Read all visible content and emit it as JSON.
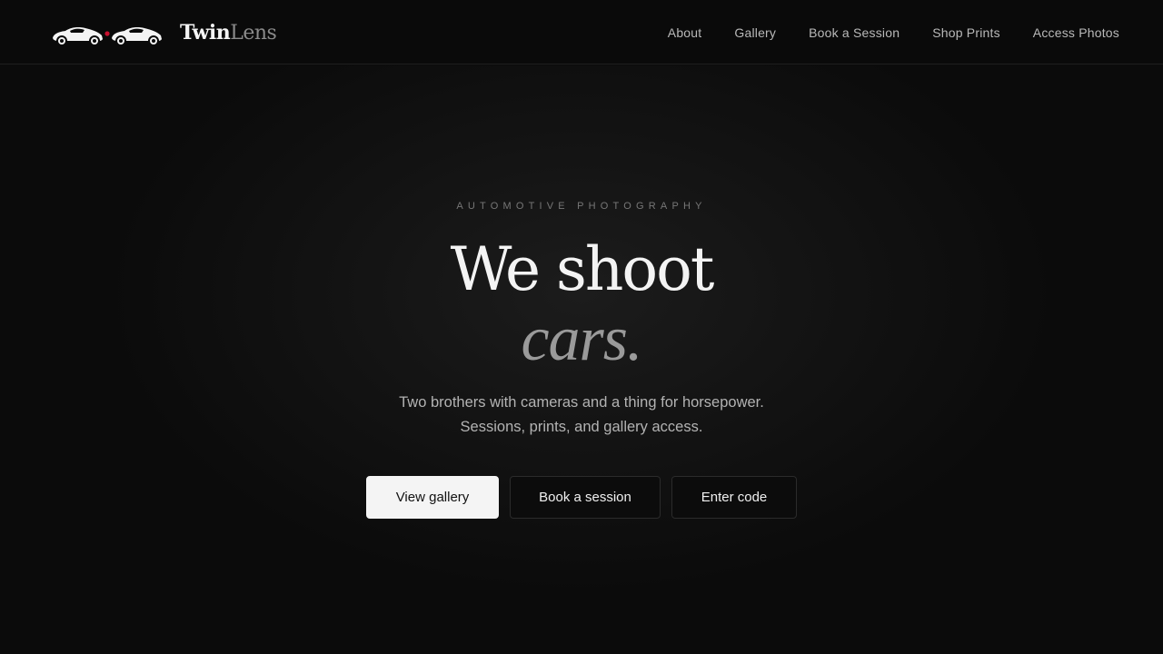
{
  "brand": {
    "name_part1": "Twin",
    "name_part2": "Lens",
    "logo_icon": "twin-cars-logo"
  },
  "nav": {
    "items": [
      {
        "label": "About"
      },
      {
        "label": "Gallery"
      },
      {
        "label": "Book a Session"
      },
      {
        "label": "Shop Prints"
      },
      {
        "label": "Access Photos"
      }
    ]
  },
  "hero": {
    "eyebrow": "AUTOMOTIVE PHOTOGRAPHY",
    "headline": "We shoot",
    "headline_emphasis": "cars.",
    "subtitle_line1": "Two brothers with cameras and a thing for horsepower.",
    "subtitle_line2": "Sessions, prints, and gallery access."
  },
  "actions": {
    "primary": "View gallery",
    "secondary": "Book a session",
    "tertiary": "Enter code"
  },
  "colors": {
    "background": "#0b0b0b",
    "accent_dot": "#c8102e",
    "primary_button": "#f4f4f4"
  }
}
